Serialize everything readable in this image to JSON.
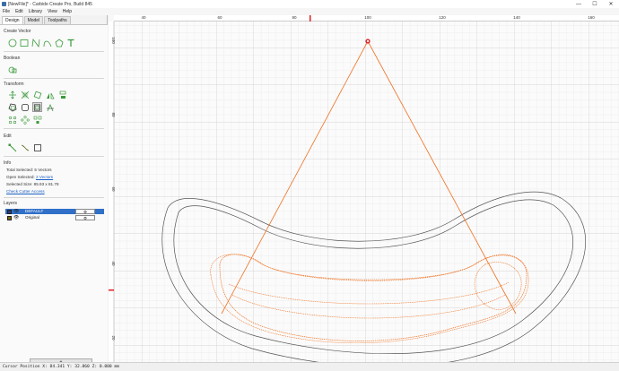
{
  "window": {
    "title": "[NewFile]* - Carbide Create Pro, Build 845",
    "minimize_glyph": "—",
    "maximize_glyph": "☐",
    "close_glyph": "✕"
  },
  "menu": [
    "File",
    "Edit",
    "Library",
    "View",
    "Help"
  ],
  "tabs": [
    "Design",
    "Model",
    "Toolpaths"
  ],
  "sections": {
    "create_vector": "Create Vector",
    "boolean": "Boolean",
    "transform": "Transform",
    "edit": "Edit",
    "info": "Info",
    "layers": "Layers"
  },
  "info": {
    "total_selected_label": "Total Selected:",
    "total_selected_value": "5 Vectors",
    "open_selected_label": "Open Selected:",
    "open_selected_value": "2 Vectors",
    "selected_size_label": "Selected Size:",
    "selected_size_value": "85.93 x 81.78",
    "check_cutter_access": "Check Cutter Access"
  },
  "layers": [
    {
      "name": "DEFAULT",
      "color": "#2a3a7a",
      "selected": true,
      "button": "⚙"
    },
    {
      "name": "Original",
      "color": "#7a6a10",
      "selected": false,
      "button": "⚙"
    }
  ],
  "add_layer_label": "+",
  "status": {
    "cursor": "Cursor Position X: 84.341 Y: 32.860 Z: 0.000 mm"
  },
  "ruler": {
    "top_labels": [
      "40",
      "60",
      "80",
      "100",
      "120",
      "140",
      "160"
    ],
    "left_labels": [
      "100",
      "80",
      "60",
      "40",
      "20"
    ]
  },
  "colors": {
    "vector_gray": "#555555",
    "vector_orange": "#f07020",
    "selection_blue": "#3070c8",
    "ruler_marker": "#e02020"
  },
  "icons": {
    "create_vector": [
      "circle-tool-icon",
      "rectangle-tool-icon",
      "polyline-tool-icon",
      "curve-tool-icon",
      "polygon-tool-icon",
      "text-tool-icon"
    ],
    "boolean": [
      "boolean-union-icon"
    ],
    "transform": [
      "move-icon",
      "scale-icon",
      "rotate-icon",
      "mirror-icon",
      "align-icon",
      "offset-icon",
      "fillet-icon",
      "join-icon",
      "trim-icon",
      "array-icon",
      "circular-array-icon",
      "distribute-icon"
    ],
    "edit": [
      "node-edit-icon",
      "smooth-icon",
      "bounding-box-icon"
    ]
  }
}
